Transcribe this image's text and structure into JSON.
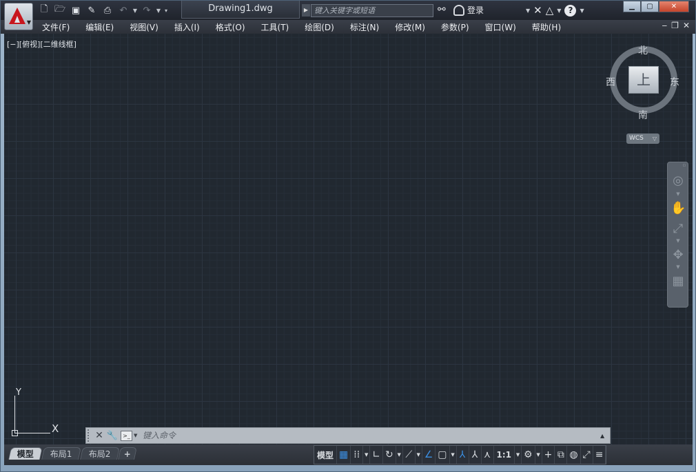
{
  "window": {
    "document_tab": "Drawing1.dwg",
    "search_placeholder": "键入关键字或短语",
    "login_label": "登录",
    "help_label": "?",
    "minimize": "▁",
    "restore": "▢",
    "close": "✕"
  },
  "quick_access": [
    {
      "name": "new-icon",
      "glyph": "🗋"
    },
    {
      "name": "open-icon",
      "glyph": "🗁"
    },
    {
      "name": "save-icon",
      "glyph": "💾"
    },
    {
      "name": "saveas-icon",
      "glyph": "✎"
    },
    {
      "name": "print-icon",
      "glyph": "⎙"
    },
    {
      "name": "undo-icon",
      "glyph": "↶"
    },
    {
      "name": "redo-icon",
      "glyph": "↷"
    }
  ],
  "menu": [
    "文件(F)",
    "编辑(E)",
    "视图(V)",
    "插入(I)",
    "格式(O)",
    "工具(T)",
    "绘图(D)",
    "标注(N)",
    "修改(M)",
    "参数(P)",
    "窗口(W)",
    "帮助(H)"
  ],
  "doc_controls": {
    "minimize": "‒",
    "restore": "❐",
    "close": "✕"
  },
  "viewport": {
    "label": "[−][俯视][二维线框]",
    "viewcube": {
      "north": "北",
      "south": "南",
      "east": "东",
      "west": "西",
      "face": "上"
    },
    "wcs": "WCS"
  },
  "ucs": {
    "x_label": "X",
    "y_label": "Y"
  },
  "command_line": {
    "placeholder": "键入命令"
  },
  "layout_tabs": [
    {
      "label": "模型",
      "active": true
    },
    {
      "label": "布局1",
      "active": false
    },
    {
      "label": "布局2",
      "active": false
    },
    {
      "label": "+",
      "active": false
    }
  ],
  "status": {
    "model_label": "模型",
    "scale_label": "1:1"
  },
  "colors": {
    "canvas": "#212830",
    "accent": "#3b8fe2",
    "logo_red": "#c8161d"
  }
}
